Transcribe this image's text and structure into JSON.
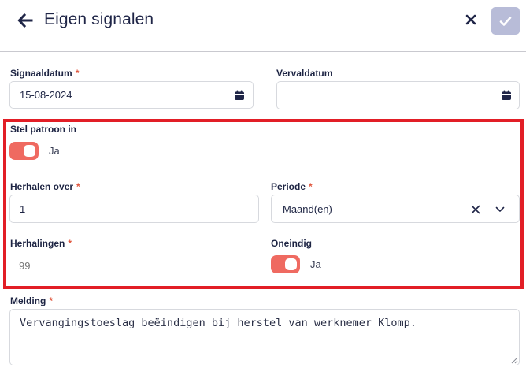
{
  "header": {
    "title": "Eigen signalen",
    "back_icon": "arrow-left-icon",
    "close_icon": "close-icon",
    "confirm_icon": "check-icon"
  },
  "form": {
    "signaaldatum": {
      "label": "Signaaldatum",
      "required": "*",
      "value": "15-08-2024",
      "icon": "calendar-icon"
    },
    "vervaldatum": {
      "label": "Vervaldatum",
      "value": "",
      "icon": "calendar-icon"
    },
    "patroon": {
      "label": "Stel patroon in",
      "toggle_text": "Ja",
      "on": true
    },
    "herhalen_over": {
      "label": "Herhalen over",
      "required": "*",
      "value": "1"
    },
    "periode": {
      "label": "Periode",
      "required": "*",
      "value": "Maand(en)"
    },
    "herhalingen": {
      "label": "Herhalingen",
      "required": "*",
      "placeholder": "99"
    },
    "oneindig": {
      "label": "Oneindig",
      "toggle_text": "Ja",
      "on": true
    },
    "melding": {
      "label": "Melding",
      "required": "*",
      "value": "Vervangingstoeslag beëindigen bij herstel van werknemer Klomp."
    }
  },
  "colors": {
    "accent_toggle": "#ef6a61",
    "required_star": "#e0563d",
    "highlight_border": "#e21e26",
    "confirm_button": "#b8bcd8",
    "text": "#1d2443"
  }
}
